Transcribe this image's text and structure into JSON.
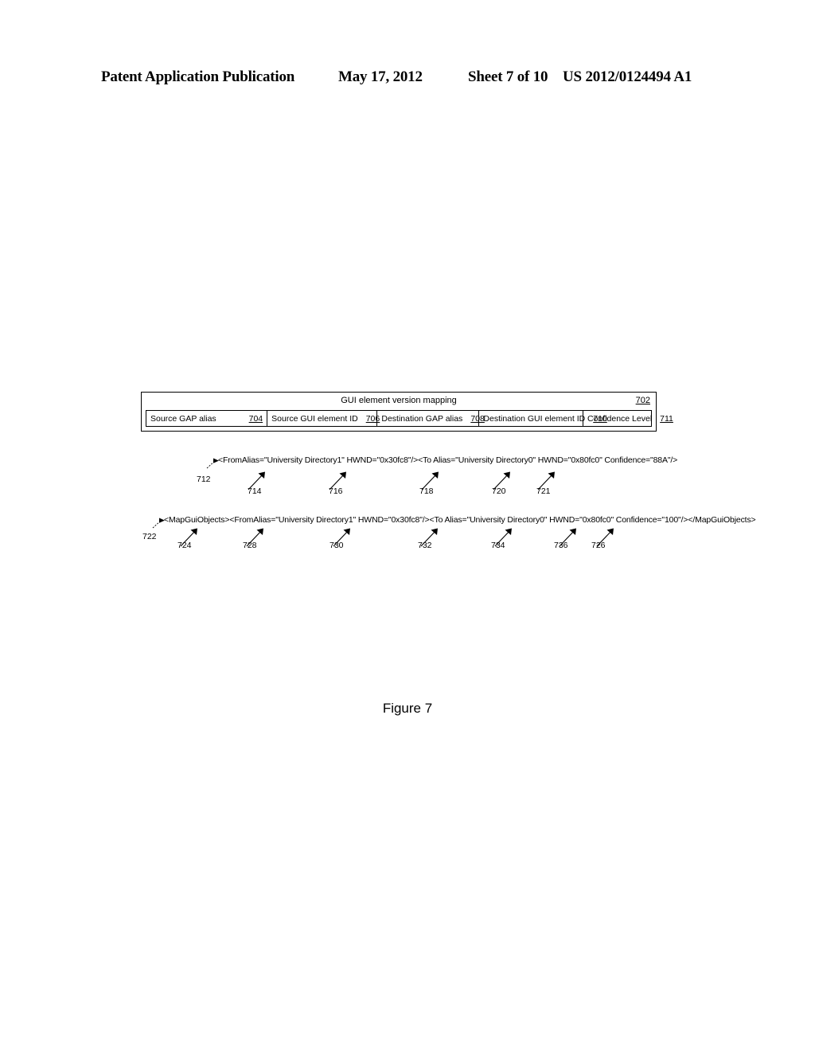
{
  "page_header": {
    "publication": "Patent Application Publication",
    "date": "May 17, 2012",
    "sheet": "Sheet 7 of 10",
    "patent_number": "US 2012/0124494 A1"
  },
  "figure": {
    "caption": "Figure 7",
    "table": {
      "title": "GUI element version mapping",
      "title_ref": "702",
      "columns": [
        {
          "label": "Source GAP alias",
          "ref": "704"
        },
        {
          "label": "Source GUI element ID",
          "ref": "706"
        },
        {
          "label": "Destination GAP alias",
          "ref": "708"
        },
        {
          "label": "Destination GUI element ID",
          "ref": "710"
        },
        {
          "label": "Confidence Level",
          "ref": "711"
        }
      ]
    },
    "code_lines": [
      {
        "text": "<FromAlias=\"University Directory1\" HWND=\"0x30fc8\"/><To Alias=\"University Directory0\" HWND=\"0x80fc0\" Confidence=\"88A\"/>",
        "line_ref": "712",
        "callouts": [
          "714",
          "716",
          "718",
          "720",
          "721"
        ]
      },
      {
        "text": "<MapGuiObjects><FromAlias=\"University Directory1\" HWND=\"0x30fc8\"/><To Alias=\"University Directory0\" HWND=\"0x80fc0\" Confidence=\"100\"/></MapGuiObjects>",
        "line_ref": "722",
        "callouts": [
          "724",
          "728",
          "730",
          "732",
          "734",
          "736",
          "726"
        ]
      }
    ],
    "refs": {
      "r702": "702",
      "r704": "704",
      "r706": "706",
      "r708": "708",
      "r710": "710",
      "r711": "711",
      "r712": "712",
      "r714": "714",
      "r716": "716",
      "r718": "718",
      "r720": "720",
      "r721": "721",
      "r722": "722",
      "r724": "724",
      "r726": "726",
      "r728": "728",
      "r730": "730",
      "r732": "732",
      "r734": "734",
      "r736": "736"
    }
  }
}
